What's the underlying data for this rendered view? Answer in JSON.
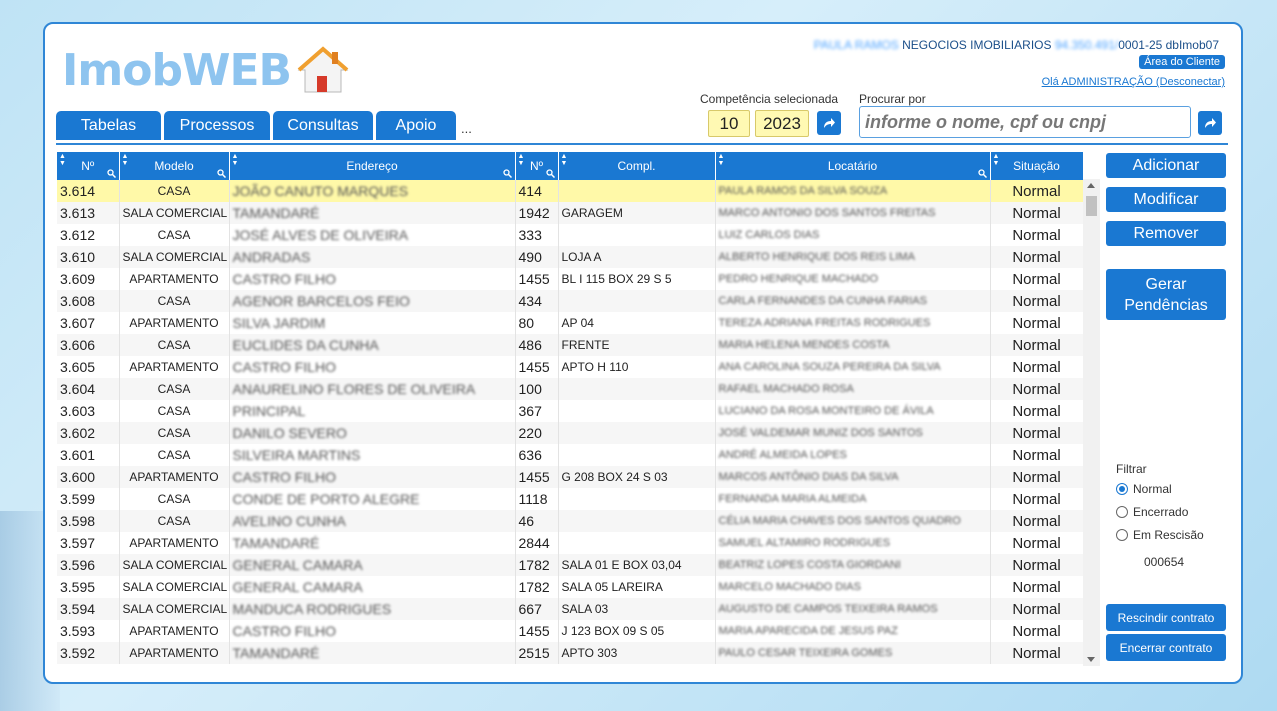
{
  "header": {
    "logo_text": "ImobWEB",
    "company_prefix": "PAULA RAMOS",
    "company_name": "NEGOCIOS IMOBILIARIOS",
    "company_code_blur": "94.350.491/",
    "company_suffix": "0001-25 dbImob07",
    "area_btn": "Área do Cliente",
    "greeting": "Olá ADMINISTRAÇÃO (Desconectar)"
  },
  "menu": {
    "items": [
      "Tabelas",
      "Processos",
      "Consultas",
      "Apoio"
    ],
    "ellipsis": "..."
  },
  "competencia": {
    "label": "Competência selecionada",
    "month": "10",
    "year": "2023"
  },
  "search": {
    "label": "Procurar por",
    "placeholder": "informe o nome, cpf ou cnpj"
  },
  "table": {
    "headers": [
      "Nº",
      "Modelo",
      "Endereço",
      "Nº",
      "Compl.",
      "Locatário",
      "Situação"
    ],
    "rows": [
      [
        "3.614",
        "CASA",
        "JOÃO CANUTO MARQUES",
        "414",
        "",
        "PAULA RAMOS DA SILVA SOUZA",
        "Normal"
      ],
      [
        "3.613",
        "SALA COMERCIAL",
        "TAMANDARÉ",
        "1942",
        "GARAGEM",
        "MARCO ANTONIO DOS SANTOS FREITAS",
        "Normal"
      ],
      [
        "3.612",
        "CASA",
        "JOSÉ ALVES DE OLIVEIRA",
        "333",
        "",
        "LUIZ CARLOS DIAS",
        "Normal"
      ],
      [
        "3.610",
        "SALA COMERCIAL",
        "ANDRADAS",
        "490",
        "LOJA A",
        "ALBERTO HENRIQUE DOS REIS LIMA",
        "Normal"
      ],
      [
        "3.609",
        "APARTAMENTO",
        "CASTRO FILHO",
        "1455",
        "BL I 115 BOX 29 S 5",
        "PEDRO HENRIQUE MACHADO",
        "Normal"
      ],
      [
        "3.608",
        "CASA",
        "AGENOR BARCELOS FEIO",
        "434",
        "",
        "CARLA FERNANDES DA CUNHA FARIAS",
        "Normal"
      ],
      [
        "3.607",
        "APARTAMENTO",
        "SILVA JARDIM",
        "80",
        "AP 04",
        "TEREZA ADRIANA FREITAS RODRIGUES",
        "Normal"
      ],
      [
        "3.606",
        "CASA",
        "EUCLIDES DA CUNHA",
        "486",
        "FRENTE",
        "MARIA HELENA MENDES COSTA",
        "Normal"
      ],
      [
        "3.605",
        "APARTAMENTO",
        "CASTRO FILHO",
        "1455",
        "APTO H 110",
        "ANA CAROLINA SOUZA PEREIRA DA SILVA",
        "Normal"
      ],
      [
        "3.604",
        "CASA",
        "ANAURELINO FLORES DE OLIVEIRA",
        "100",
        "",
        "RAFAEL MACHADO ROSA",
        "Normal"
      ],
      [
        "3.603",
        "CASA",
        "PRINCIPAL",
        "367",
        "",
        "LUCIANO DA ROSA MONTEIRO DE ÁVILA",
        "Normal"
      ],
      [
        "3.602",
        "CASA",
        "DANILO SEVERO",
        "220",
        "",
        "JOSÉ VALDEMAR MUNIZ DOS SANTOS",
        "Normal"
      ],
      [
        "3.601",
        "CASA",
        "SILVEIRA MARTINS",
        "636",
        "",
        "ANDRÉ ALMEIDA LOPES",
        "Normal"
      ],
      [
        "3.600",
        "APARTAMENTO",
        "CASTRO FILHO",
        "1455",
        "G 208 BOX 24 S 03",
        "MARCOS ANTÔNIO DIAS DA SILVA",
        "Normal"
      ],
      [
        "3.599",
        "CASA",
        "CONDE DE PORTO ALEGRE",
        "1118",
        "",
        "FERNANDA MARIA ALMEIDA",
        "Normal"
      ],
      [
        "3.598",
        "CASA",
        "AVELINO CUNHA",
        "46",
        "",
        "CÉLIA MARIA CHAVES DOS SANTOS QUADRO",
        "Normal"
      ],
      [
        "3.597",
        "APARTAMENTO",
        "TAMANDARÉ",
        "2844",
        "",
        "SAMUEL ALTAMIRO RODRIGUES",
        "Normal"
      ],
      [
        "3.596",
        "SALA COMERCIAL",
        "GENERAL CAMARA",
        "1782",
        "SALA 01 E BOX 03,04",
        "BEATRIZ LOPES COSTA GIORDANI",
        "Normal"
      ],
      [
        "3.595",
        "SALA COMERCIAL",
        "GENERAL CAMARA",
        "1782",
        "SALA 05 LAREIRA",
        "MARCELO MACHADO DIAS",
        "Normal"
      ],
      [
        "3.594",
        "SALA COMERCIAL",
        "MANDUCA RODRIGUES",
        "667",
        "SALA 03",
        "AUGUSTO DE CAMPOS TEIXEIRA RAMOS",
        "Normal"
      ],
      [
        "3.593",
        "APARTAMENTO",
        "CASTRO FILHO",
        "1455",
        "J 123 BOX 09 S 05",
        "MARIA APARECIDA DE JESUS PAZ",
        "Normal"
      ],
      [
        "3.592",
        "APARTAMENTO",
        "TAMANDARÉ",
        "2515",
        "APTO 303",
        "PAULO CESAR TEIXEIRA GOMES",
        "Normal"
      ]
    ]
  },
  "actions": {
    "add": "Adicionar",
    "edit": "Modificar",
    "remove": "Remover",
    "generate_line1": "Gerar",
    "generate_line2": "Pendências",
    "rescind": "Rescindir contrato",
    "close": "Encerrar contrato"
  },
  "filter": {
    "title": "Filtrar",
    "options": [
      "Normal",
      "Encerrado",
      "Em Rescisão"
    ],
    "selected": "Normal",
    "count": "000654"
  },
  "colors": {
    "accent": "#1a78d2",
    "selected_row": "#fff9a8",
    "logo": "#8ec4ef"
  }
}
